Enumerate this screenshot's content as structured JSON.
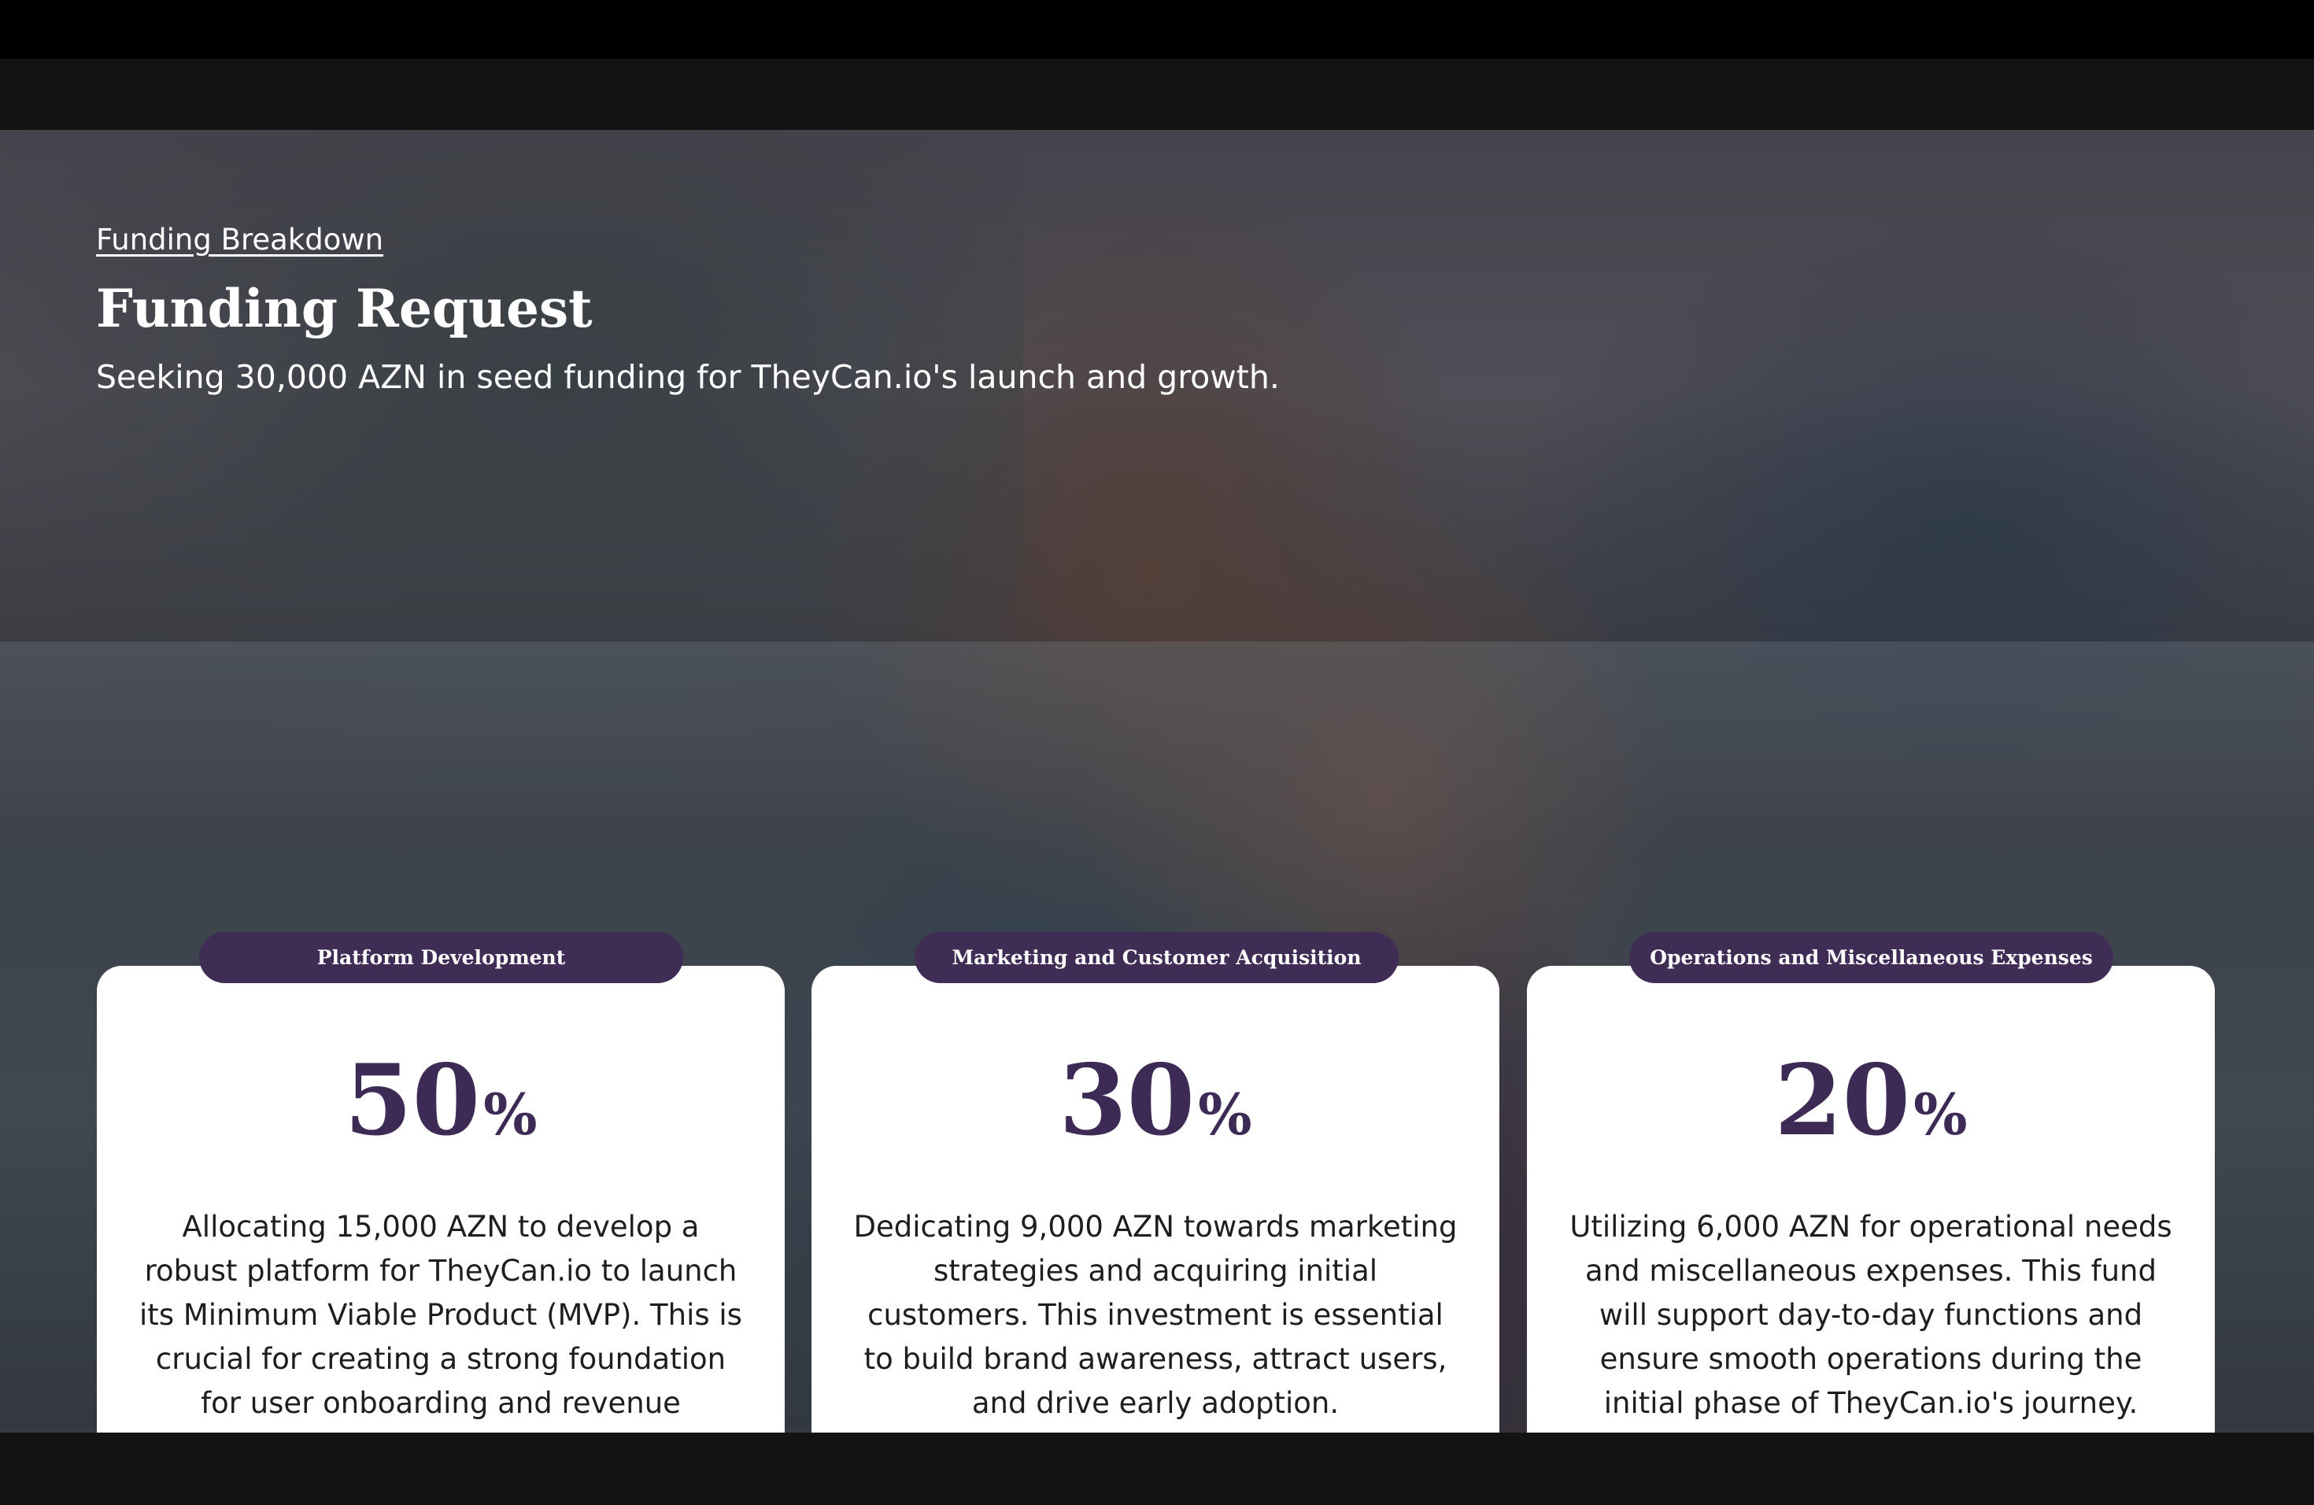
{
  "slide": {
    "eyebrow": "Funding Breakdown",
    "title": "Funding Request",
    "subtitle": "Seeking 30,000 AZN in seed funding for TheyCan.io's launch and growth."
  },
  "cards": [
    {
      "tag": "Platform Development",
      "percent": "50",
      "percent_symbol": "%",
      "description": "Allocating 15,000 AZN to develop a robust platform for TheyCan.io to launch its Minimum Viable Product (MVP). This is crucial for creating a strong foundation for user onboarding and revenue generation."
    },
    {
      "tag": "Marketing and Customer Acquisition",
      "percent": "30",
      "percent_symbol": "%",
      "description": "Dedicating 9,000 AZN towards marketing strategies and acquiring initial customers. This investment is essential to build brand awareness, attract users, and drive early adoption."
    },
    {
      "tag": "Operations and Miscellaneous Expenses",
      "percent": "20",
      "percent_symbol": "%",
      "description": "Utilizing 6,000 AZN for operational needs and miscellaneous expenses. This fund will support day-to-day functions and ensure smooth operations during the initial phase of TheyCan.io's journey."
    }
  ],
  "colors": {
    "accent": "#3f2d55",
    "card_background": "#ffffff",
    "text_on_dark": "#ffffff"
  }
}
